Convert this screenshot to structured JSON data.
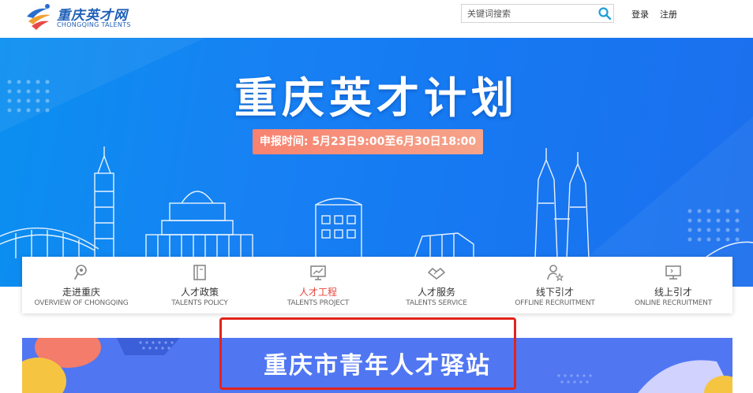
{
  "header": {
    "logo_cn": "重庆英才网",
    "logo_en": "CHONGQING TALENTS",
    "search_placeholder": "关键词搜索",
    "login": "登录",
    "register": "注册"
  },
  "banner": {
    "title": "重庆英才计划",
    "deadline": "申报时间: 5月23日9:00至6月30日18:00"
  },
  "nav": {
    "items": [
      {
        "cn": "走进重庆",
        "en": "OVERVIEW OF CHONGQING",
        "icon": "pin-icon"
      },
      {
        "cn": "人才政策",
        "en": "TALENTS POLICY",
        "icon": "book-icon"
      },
      {
        "cn": "人才工程",
        "en": "TALENTS PROJECT",
        "icon": "monitor-chart-icon"
      },
      {
        "cn": "人才服务",
        "en": "TALENTS SERVICE",
        "icon": "handshake-icon"
      },
      {
        "cn": "线下引才",
        "en": "OFFLINE RECRUITMENT",
        "icon": "person-star-icon"
      },
      {
        "cn": "线上引才",
        "en": "ONLINE RECRUITMENT",
        "icon": "computer-icon"
      }
    ],
    "active_index": 2
  },
  "feature": {
    "title": "重庆市青年人才驿站"
  },
  "colors": {
    "brand": "#1f5fb8",
    "banner_blue": "#1679f2",
    "pill": "#f7826f",
    "active": "#e8443a",
    "highlight_box": "#e3231b",
    "feature_bg": "#5076f2"
  }
}
